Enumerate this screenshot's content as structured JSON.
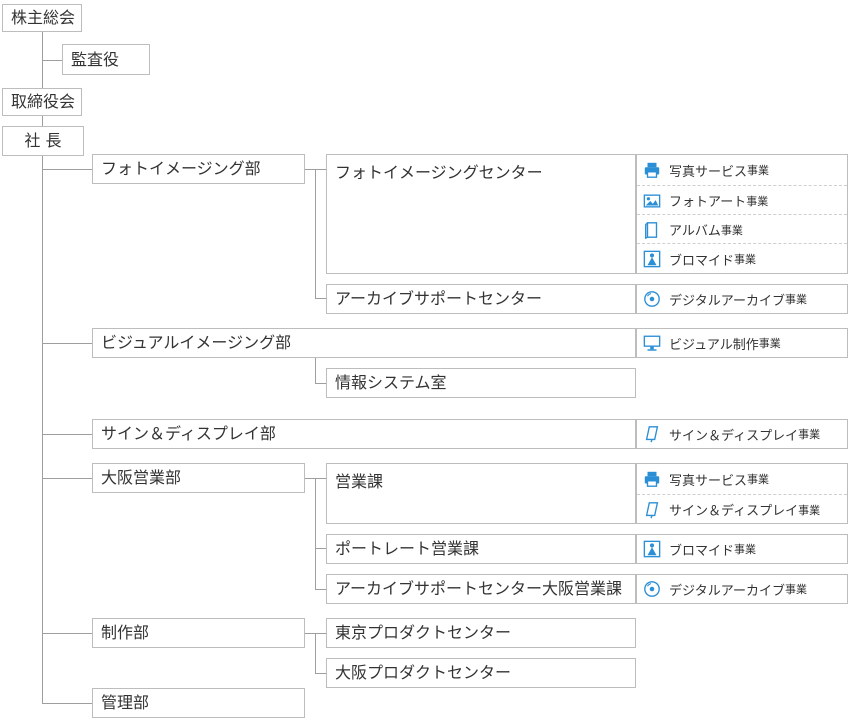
{
  "top_chain": {
    "shareholders": "株主総会",
    "auditor": "監査役",
    "board": "取締役会",
    "president": "社 長"
  },
  "departments": {
    "photo": {
      "name": "フォトイメージング部",
      "centers": {
        "photo_center": "フォトイメージングセンター",
        "archive_center": "アーカイブサポートセンター"
      }
    },
    "visual": {
      "name": "ビジュアルイメージング部",
      "info_room": "情報システム室"
    },
    "sign": {
      "name": "サイン＆ディスプレイ部"
    },
    "osaka": {
      "name": "大阪営業部",
      "sales": "営業課",
      "portrait": "ポートレート営業課",
      "archive_osaka": "アーカイブサポートセンター大阪営業課"
    },
    "production": {
      "name": "制作部",
      "tokyo": "東京プロダクトセンター",
      "osaka": "大阪プロダクトセンター"
    },
    "admin": {
      "name": "管理部"
    }
  },
  "business_suffix": "事業",
  "business": {
    "photo_center": [
      {
        "label": "写真サービス",
        "icon": "printer-icon"
      },
      {
        "label": "フォトアート",
        "icon": "picture-icon"
      },
      {
        "label": "アルバム",
        "icon": "album-icon"
      },
      {
        "label": "ブロマイド",
        "icon": "bromide-icon"
      }
    ],
    "archive_center": [
      {
        "label": "デジタルアーカイブ",
        "icon": "disc-icon"
      }
    ],
    "visual": [
      {
        "label": "ビジュアル制作",
        "icon": "monitor-icon"
      }
    ],
    "sign": [
      {
        "label": "サイン＆ディスプレイ",
        "icon": "sign-icon"
      }
    ],
    "osaka_sales": [
      {
        "label": "写真サービス",
        "icon": "printer-icon"
      },
      {
        "label": "サイン＆ディスプレイ",
        "icon": "sign-icon"
      }
    ],
    "portrait": [
      {
        "label": "ブロマイド",
        "icon": "bromide-icon"
      }
    ],
    "archive_osaka": [
      {
        "label": "デジタルアーカイブ",
        "icon": "disc-icon"
      }
    ]
  },
  "colors": {
    "icon": "#2b8fd6",
    "border": "#bdbdbd",
    "line": "#9e9e9e",
    "text": "#333333"
  }
}
